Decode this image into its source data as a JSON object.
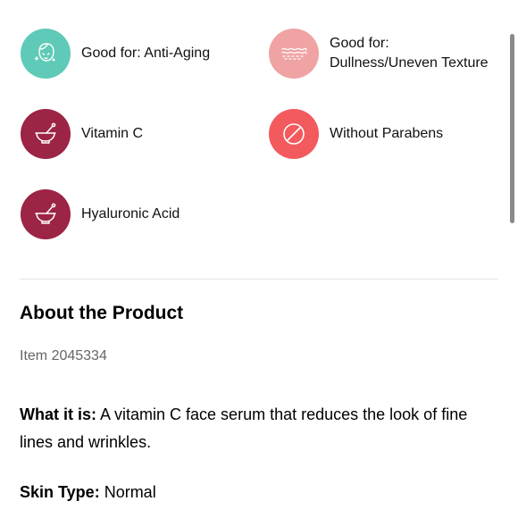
{
  "highlights": [
    {
      "label": "Good for: Anti-Aging",
      "icon": "face-sparkle-icon",
      "color": "#5ecab7"
    },
    {
      "label_line1": "Good for:",
      "label_line2": "Dullness/Uneven Texture",
      "icon": "skin-texture-icon",
      "color": "#f0a3a3"
    },
    {
      "label": "Vitamin C",
      "icon": "mortar-pestle-icon",
      "color": "#9c2445"
    },
    {
      "label": "Without Parabens",
      "icon": "prohibited-icon",
      "color": "#f25a5e"
    },
    {
      "label": "Hyaluronic Acid",
      "icon": "mortar-pestle-icon",
      "color": "#9c2445"
    }
  ],
  "about": {
    "title": "About the Product",
    "item_number": "Item 2045334",
    "what_it_is_label": "What it is:",
    "what_it_is_text": " A vitamin C face serum that reduces the look of fine lines and wrinkles.",
    "skin_type_label": "Skin Type:",
    "skin_type_value": " Normal"
  }
}
